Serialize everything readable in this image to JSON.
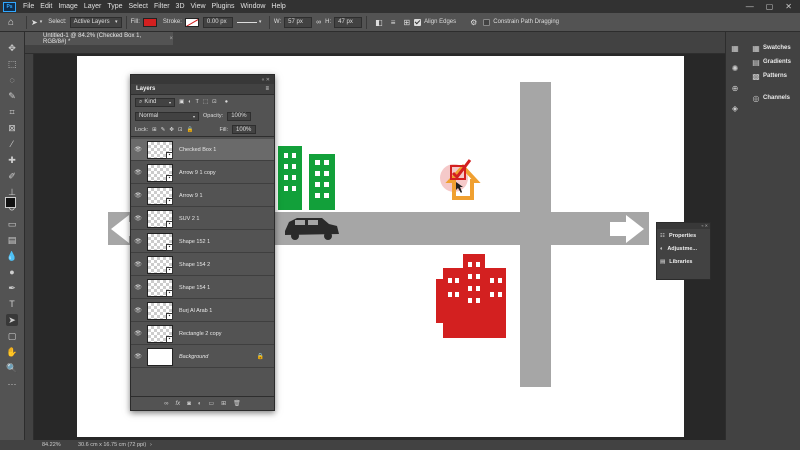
{
  "app": {
    "logo": "Ps"
  },
  "menu": [
    "File",
    "Edit",
    "Image",
    "Layer",
    "Type",
    "Select",
    "Filter",
    "3D",
    "View",
    "Plugins",
    "Window",
    "Help"
  ],
  "window_buttons": [
    "—",
    "▢",
    "✕"
  ],
  "options_bar": {
    "select_label": "Select:",
    "select_value": "Active Layers",
    "fill_label": "Fill:",
    "fill_color": "#d32020",
    "stroke_label": "Stroke:",
    "stroke_width": "0.00 px",
    "w_label": "W:",
    "w_value": "57 px",
    "h_label": "H:",
    "h_value": "47 px",
    "align_edges": "Align Edges",
    "constrain": "Constrain Path Dragging"
  },
  "document_tab": {
    "title": "Untitled-1 @ 84.2% (Checked Box 1, RGB/8#) *",
    "close": "×"
  },
  "layers_panel": {
    "title": "Layers",
    "filter_kind": "Kind",
    "blend_mode": "Normal",
    "opacity_label": "Opacity:",
    "opacity_value": "100%",
    "lock_label": "Lock:",
    "fill_label": "Fill:",
    "fill_value": "100%",
    "layers": [
      {
        "name": "Checked Box 1",
        "active": true
      },
      {
        "name": "Arrow 9 1 copy",
        "active": false
      },
      {
        "name": "Arrow 9 1",
        "active": false
      },
      {
        "name": "SUV 2 1",
        "active": false
      },
      {
        "name": "Shape 152 1",
        "active": false
      },
      {
        "name": "Shape 154 2",
        "active": false
      },
      {
        "name": "Shape 154 1",
        "active": false
      },
      {
        "name": "Burj Al Arab 1",
        "active": false
      },
      {
        "name": "Rectangle 2 copy",
        "active": false
      },
      {
        "name": "Background",
        "active": false
      }
    ],
    "footer_icons": [
      "link-icon",
      "fx-icon",
      "mask-icon",
      "adjustment-icon",
      "group-icon",
      "new-layer-icon",
      "trash-icon"
    ]
  },
  "right_dock": {
    "swatches": "Swatches",
    "gradients": "Gradients",
    "patterns": "Patterns",
    "channels": "Channels"
  },
  "props_panel": {
    "properties": "Properties",
    "adjustments": "Adjustme...",
    "libraries": "Libraries"
  },
  "status": {
    "zoom": "84.22%",
    "doc_size": "30.6 cm x 16.75 cm (72 ppi)"
  },
  "colors": {
    "accent_red": "#d32020",
    "building_green": "#12a03a",
    "house_orange": "#f0a030",
    "road_gray": "#a6a6a6",
    "car_dark": "#2a2a2a"
  }
}
